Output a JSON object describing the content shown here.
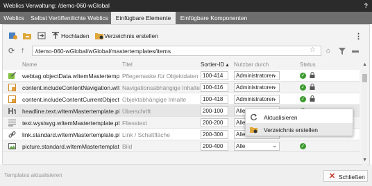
{
  "window": {
    "title": "Weblics Verwaltung: /demo-060-wGlobal",
    "help": "?"
  },
  "tabs": [
    {
      "label": "Weblics"
    },
    {
      "label": "Selbst Veröffentlichte Weblics"
    },
    {
      "label": "Einfügbare Elemente"
    },
    {
      "label": "Einfügbare Komponenten"
    }
  ],
  "toolbar": {
    "upload_label": "Hochladen",
    "create_dir_label": "Verzeichnis erstellen",
    "more": "⋮"
  },
  "path": {
    "value": "/demo-060-wGlobal/wGlobal/mastertemplates/items"
  },
  "table": {
    "headers": {
      "name": "Name",
      "title": "Titel",
      "sort": "Sortier-ID ▴",
      "usable": "Nutzbar durch",
      "status": "Status"
    },
    "rows": [
      {
        "name": "webtag.objectData.wItemMastertemplate.p",
        "title": "Pflegemaske für Objektdaten",
        "sort": "100-414",
        "usable": "Administratoren",
        "ok": true,
        "lock": true,
        "icon": "mask-icon"
      },
      {
        "name": "content.includeContentNavigation.wItem",
        "title": "Navigationsabhängige Inhalte",
        "sort": "100-416",
        "usable": "Administratoren",
        "ok": true,
        "lock": true,
        "icon": "include-icon"
      },
      {
        "name": "content.includeContentCurrentObject.wIt",
        "title": "Objektabhängige Inhalte",
        "sort": "100-418",
        "usable": "Administratoren",
        "ok": true,
        "lock": true,
        "icon": "include-icon"
      },
      {
        "name": "headline.text.wItemMastertemplate.php",
        "title": "Überschrift",
        "sort": "200-100",
        "usable": "Alle",
        "ok": true,
        "lock": false,
        "icon": "headline-icon"
      },
      {
        "name": "text.wysiwyg.wItemMastertemplate.php",
        "title": "Fliesstext",
        "sort": "200-200",
        "usable": "Alle",
        "ok": true,
        "lock": false,
        "icon": "text-icon"
      },
      {
        "name": "link.standard.wItemMastertemplate.php",
        "title": "Link / Schaltfläche",
        "sort": "200-300",
        "usable": "Alle",
        "ok": true,
        "lock": false,
        "icon": "link-icon"
      },
      {
        "name": "picture.standard.wItemMastertemplate.p",
        "title": "Bild",
        "sort": "200-400",
        "usable": "Alle",
        "ok": true,
        "lock": false,
        "icon": "picture-icon"
      }
    ]
  },
  "context_menu": {
    "refresh_label": "Aktualisieren",
    "create_dir_label": "Verzeichnis erstellen"
  },
  "footer": {
    "status": "Templates aktualisieren",
    "close_label": "Schließen"
  },
  "colors": {
    "titlebar": "#2b2b2b",
    "tabbar": "#6e6e6e",
    "ok_green": "#3a9a2c",
    "close_red": "#c0392b"
  }
}
